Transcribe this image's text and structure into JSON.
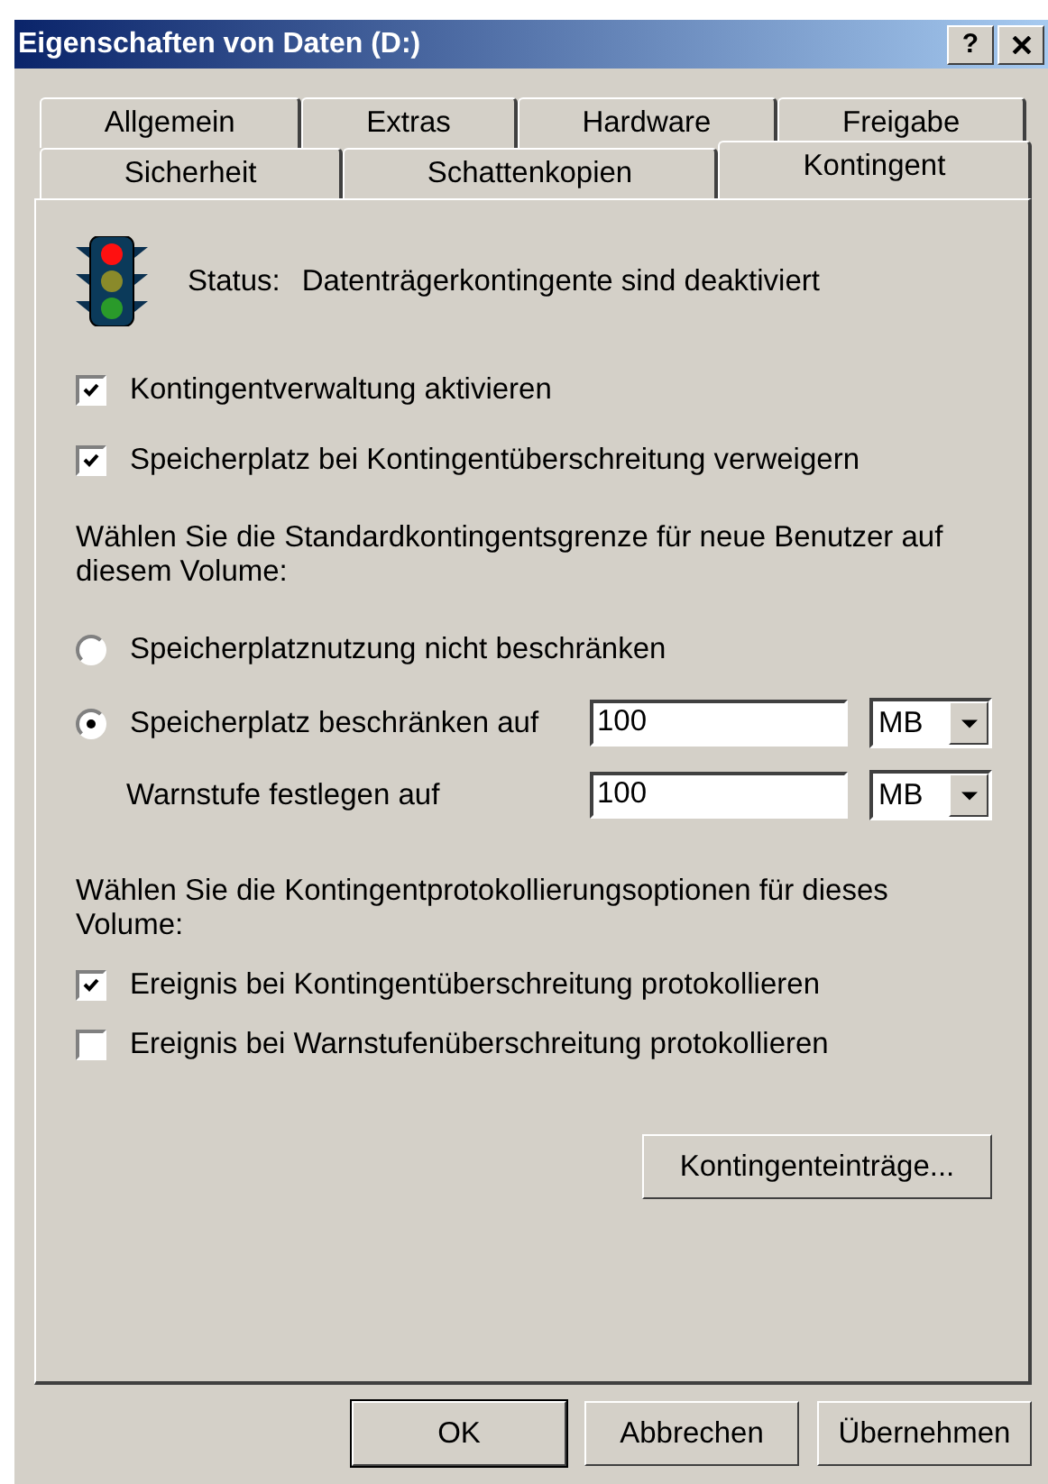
{
  "window": {
    "title": "Eigenschaften von Daten (D:)",
    "help_button": "?"
  },
  "tab_rows": [
    [
      {
        "label": "Allgemein",
        "selected": false
      },
      {
        "label": "Extras",
        "selected": false
      },
      {
        "label": "Hardware",
        "selected": false
      },
      {
        "label": "Freigabe",
        "selected": false
      }
    ],
    [
      {
        "label": "Sicherheit",
        "selected": false
      },
      {
        "label": "Schattenkopien",
        "selected": false
      },
      {
        "label": "Kontingent",
        "selected": true
      }
    ]
  ],
  "status": {
    "label": "Status:",
    "text": "Datenträgerkontingente sind deaktiviert"
  },
  "quota_options": [
    {
      "label": "Kontingentverwaltung aktivieren",
      "checked": true
    },
    {
      "label": "Speicherplatz bei Kontingentüberschreitung verweigern",
      "checked": true
    }
  ],
  "limit_prompt": "Wählen Sie die Standardkontingentsgrenze für neue Benutzer auf diesem Volume:",
  "limit_choices": [
    {
      "label": "Speicherplatznutzung nicht beschränken",
      "selected": false
    },
    {
      "label": "Speicherplatz beschränken auf",
      "selected": true
    }
  ],
  "limit": {
    "value": "100",
    "unit": "MB"
  },
  "warning": {
    "label": "Warnstufe festlegen auf",
    "value": "100",
    "unit": "MB"
  },
  "log_prompt": "Wählen Sie die Kontingentprotokollierungsoptionen für dieses Volume:",
  "log_options": [
    {
      "label": "Ereignis bei Kontingentüberschreitung protokollieren",
      "checked": true
    },
    {
      "label": "Ereignis bei Warnstufenüberschreitung protokollieren",
      "checked": false
    }
  ],
  "entries_button": "Kontingenteinträge...",
  "buttons": [
    "OK",
    "Abbrechen",
    "Übernehmen"
  ]
}
